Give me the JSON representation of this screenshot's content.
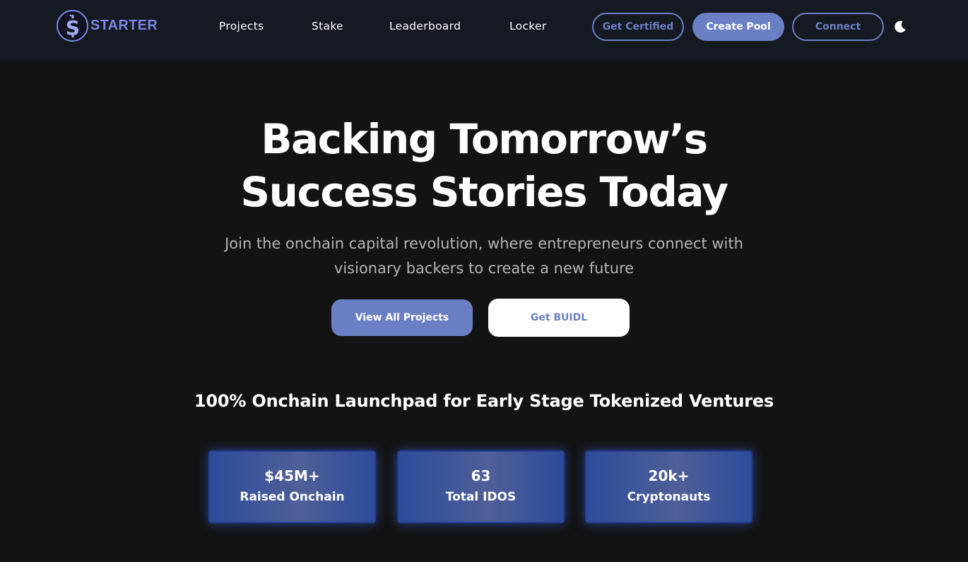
{
  "brand": {
    "name": "STARTER",
    "accent": "#7b87e6",
    "button_color": "#6b80c4"
  },
  "nav": {
    "links": [
      "Projects",
      "Stake",
      "Leaderboard",
      "Locker"
    ],
    "get_certified": "Get Certified",
    "create_pool": "Create Pool",
    "connect": "Connect",
    "theme_icon": "moon-icon"
  },
  "hero": {
    "title_line1": "Backing Tomorrow’s",
    "title_line2": "Success Stories Today",
    "subtitle": "Join the onchain capital revolution, where entrepreneurs connect with visionary backers to create a new future",
    "view_projects": "View All Projects",
    "get_buidl": "Get BUIDL"
  },
  "tagline": "100% Onchain Launchpad for Early Stage Tokenized Ventures",
  "stats": [
    {
      "value": "$45M+",
      "label": "Raised Onchain"
    },
    {
      "value": "63",
      "label": "Total IDOS"
    },
    {
      "value": "20k+",
      "label": "Cryptonauts"
    }
  ]
}
